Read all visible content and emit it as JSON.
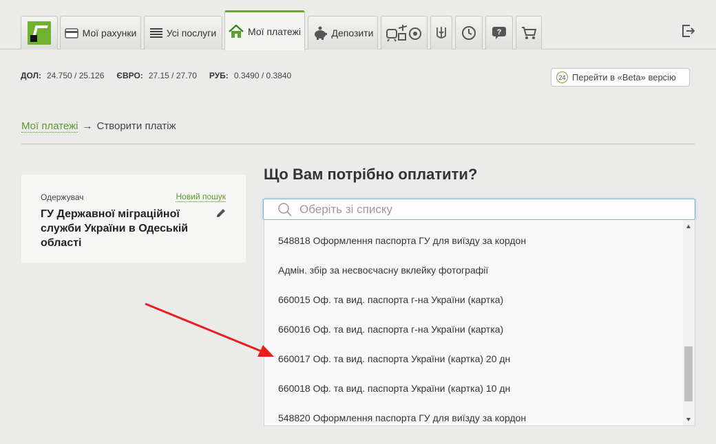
{
  "nav": {
    "tabs": [
      {
        "label": "Мої рахунки",
        "icon": "card-icon"
      },
      {
        "label": "Усі послуги",
        "icon": "list-icon"
      },
      {
        "label": "Мої платежі",
        "icon": "home-icon",
        "active": true
      },
      {
        "label": "Депозити",
        "icon": "piggy-bank-icon"
      }
    ],
    "icon_tabs": [
      "travel-icon",
      "trident-icon",
      "history-icon",
      "help-icon",
      "cart-icon"
    ],
    "accent": "#6aa832"
  },
  "rates": [
    {
      "name": "ДОЛ:",
      "value": "24.750 / 25.126"
    },
    {
      "name": "ЄВРО:",
      "value": "27.15 / 27.70"
    },
    {
      "name": "РУБ:",
      "value": "0.3490 / 0.3840"
    }
  ],
  "beta": {
    "badge": "24",
    "label": "Перейти в «Beta» версію"
  },
  "breadcrumb": {
    "link": "Мої платежі",
    "separator": "→",
    "current": "Створити платіж"
  },
  "recipient": {
    "label": "Одержувач",
    "new_search": "Новий пошук",
    "name": "ГУ Державної міграційної служби України в Одеській області"
  },
  "main": {
    "title": "Що Вам потрібно оплатити?",
    "search_placeholder": "Оберіть зі списку",
    "options": [
      "548818 Оформлення паспорта ГУ для виїзду за кордон",
      "Адмін. збір за несвоєчасну вклейку фотографії",
      "660015 Оф. та вид. паспорта г-на України (картка)",
      "660016 Оф. та вид. паспорта г-на України (картка)",
      "660017 Оф. та вид. паспорта України (картка) 20 дн",
      "660018 Оф. та вид. паспорта України (картка) 10 дн",
      "548820 Оформлення паспорта ГУ для виїзду за кордон"
    ],
    "highlighted_index": 4,
    "arrow_color": "#ee1c1c"
  }
}
